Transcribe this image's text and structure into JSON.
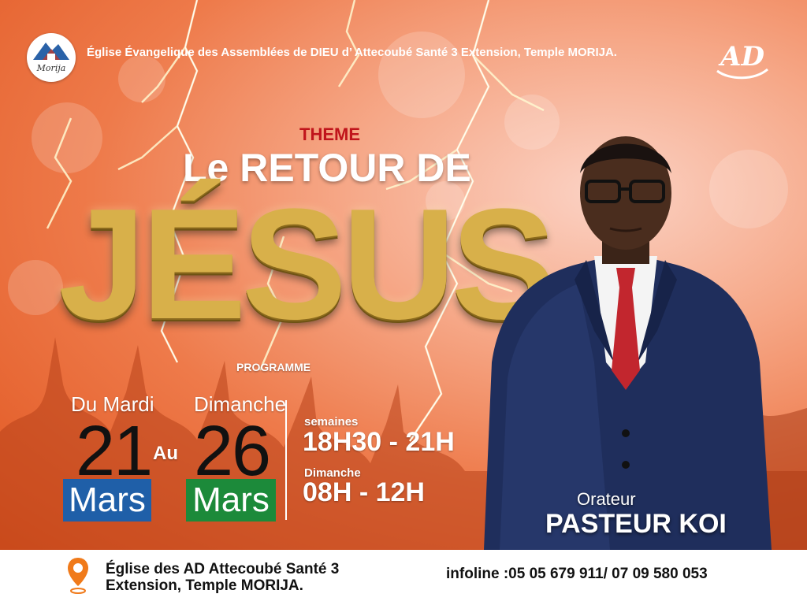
{
  "header": {
    "church_name": "Église Évangelique des Assemblées de DIEU d’ Attecoubé Santé 3 Extension,  Temple MORIJA.",
    "logo_left_text": "Morija",
    "logo_right_text": "AD"
  },
  "theme": {
    "label": "THEME",
    "title_line": "Le RETOUR DE",
    "title_big": "JÉSUS",
    "programme_label": "PROGRAMME"
  },
  "dates": {
    "start_label": "Du Mardi",
    "start_day": "21",
    "start_month": "Mars",
    "connector": "Au",
    "end_label": "Dimanche",
    "end_day": "26",
    "end_month": "Mars"
  },
  "schedule": {
    "weekdays_label": "semaines",
    "weekdays_time": "18H30 - 21H",
    "sunday_label": "Dimanche",
    "sunday_time": "08H - 12H"
  },
  "speaker": {
    "role": "Orateur",
    "name": "PASTEUR KOI"
  },
  "footer": {
    "address_line1": "Église des AD Attecoubé Santé 3",
    "address_line2": "Extension, Temple MORIJA.",
    "infoline": "infoline :05 05 679 911/ 07 09 580 053"
  },
  "colors": {
    "background_orange": "#e0551f",
    "theme_red": "#c0141b",
    "gold": "#d8b04a",
    "blue_box": "#1f5fa8",
    "green_box": "#1c8a3a",
    "pin_orange": "#f07a1a"
  }
}
